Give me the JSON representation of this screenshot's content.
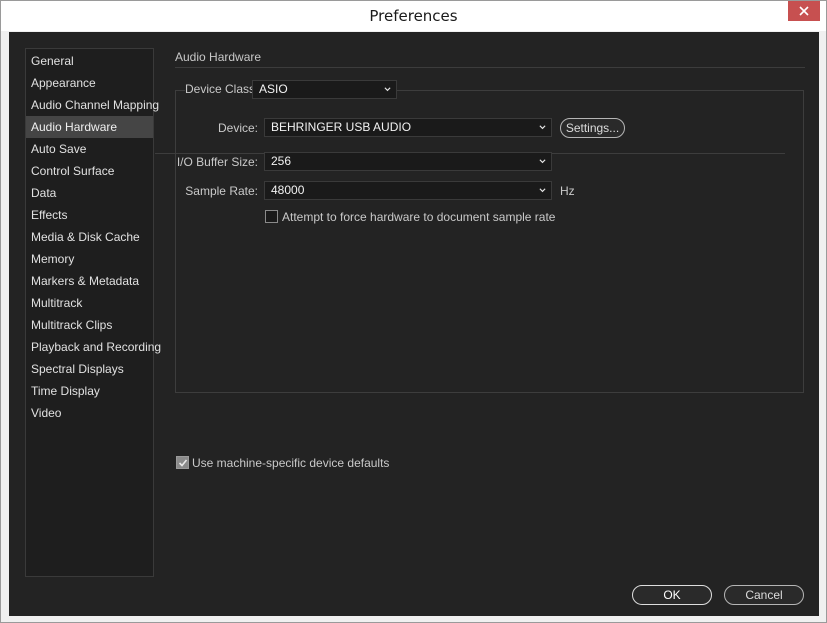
{
  "window": {
    "title": "Preferences",
    "close_icon": "close-icon"
  },
  "sidebar": {
    "items": [
      {
        "label": "General"
      },
      {
        "label": "Appearance"
      },
      {
        "label": "Audio Channel Mapping"
      },
      {
        "label": "Audio Hardware",
        "active": true
      },
      {
        "label": "Auto Save"
      },
      {
        "label": "Control Surface"
      },
      {
        "label": "Data"
      },
      {
        "label": "Effects"
      },
      {
        "label": "Media & Disk Cache"
      },
      {
        "label": "Memory"
      },
      {
        "label": "Markers & Metadata"
      },
      {
        "label": "Multitrack"
      },
      {
        "label": "Multitrack Clips"
      },
      {
        "label": "Playback and Recording"
      },
      {
        "label": "Spectral Displays"
      },
      {
        "label": "Time Display"
      },
      {
        "label": "Video"
      }
    ]
  },
  "main": {
    "section_title": "Audio Hardware",
    "device_class": {
      "label": "Device Class:",
      "value": "ASIO"
    },
    "device": {
      "label": "Device:",
      "value": "BEHRINGER USB AUDIO",
      "settings_label": "Settings..."
    },
    "buffer_size": {
      "label": "I/O Buffer Size:",
      "value": "256"
    },
    "sample_rate": {
      "label": "Sample Rate:",
      "value": "48000",
      "unit": "Hz"
    },
    "force_rate": {
      "label": "Attempt to force hardware to document sample rate",
      "checked": false
    },
    "machine_defaults": {
      "label": "Use machine-specific device defaults",
      "checked": true
    }
  },
  "footer": {
    "ok_label": "OK",
    "cancel_label": "Cancel"
  },
  "colors": {
    "client_bg": "#232323",
    "sidebar_bg": "#1e1e1e",
    "active_item": "#454545",
    "close_red": "#c75050"
  }
}
